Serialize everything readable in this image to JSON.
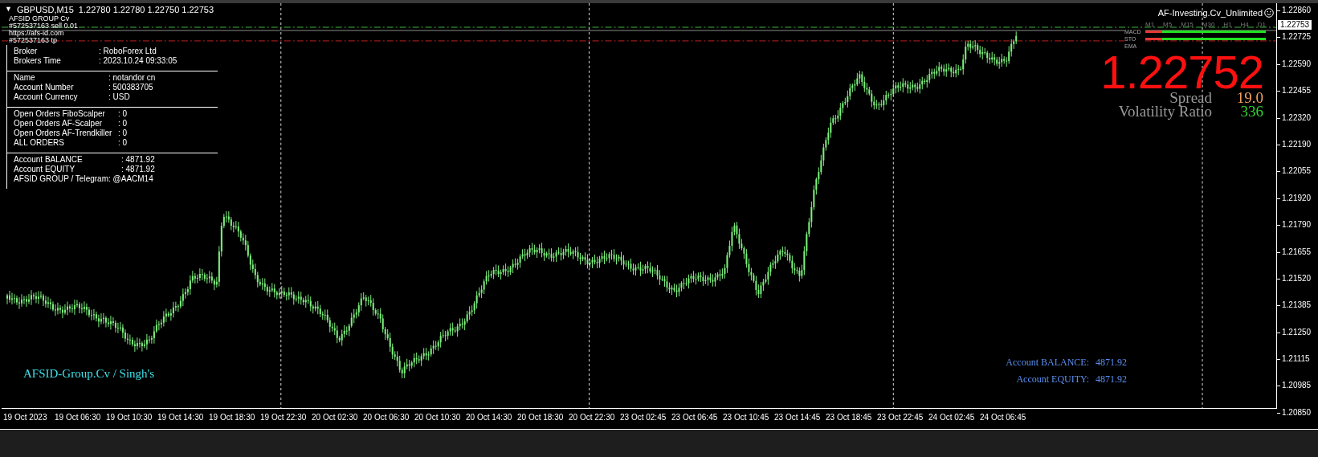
{
  "chart_header": {
    "collapse_glyph": "▼",
    "symbol": "GBPUSD,M15",
    "ohlc": "1.22780 1.22780 1.22750 1.22753"
  },
  "order_labels": [
    "AFSID GROUP Cv",
    "#572537163 sell 0.01",
    "https://afs-id.com",
    "#572537163 tp"
  ],
  "info_panel": {
    "sections": [
      [
        {
          "label": "Broker",
          "value": ": RoboForex Ltd"
        },
        {
          "label": "Brokers Time",
          "value": ": 2023.10.24 09:33:05"
        }
      ],
      [
        {
          "label": "Name",
          "value": ": notandor cn"
        },
        {
          "label": "Account Number",
          "value": ": 500383705"
        },
        {
          "label": "Account Currency",
          "value": ": USD"
        }
      ],
      [
        {
          "label": "Open Orders FiboScalper",
          "value": ": 0"
        },
        {
          "label": "Open Orders AF-Scalper",
          "value": ": 0"
        },
        {
          "label": "Open Orders AF-Trendkiller",
          "value": ": 0"
        },
        {
          "label": "ALL ORDERS",
          "value": ": 0"
        }
      ],
      [
        {
          "label": "Account BALANCE",
          "value": ": 4871.92"
        },
        {
          "label": "Account EQUITY",
          "value": ": 4871.92"
        },
        {
          "label": "AFSID GROUP / Telegram: @AACM14"
        }
      ]
    ]
  },
  "expert": {
    "name": "AF-Investing.Cv_Unlimited"
  },
  "signal_panel": {
    "timeframes": [
      "M1",
      "M5",
      "M15",
      "M30",
      "H1",
      "H4",
      "D1"
    ],
    "rows": [
      {
        "label": "MACD",
        "cells": [
          {
            "color": "#e53935"
          },
          {
            "color": "#22e022"
          },
          {
            "color": "#22e022"
          },
          {
            "color": "#22e022"
          },
          {
            "color": "#22e022"
          },
          {
            "color": "#22e022"
          },
          {
            "color": "#22e022"
          }
        ]
      },
      {
        "label": "STO",
        "cells": [
          {
            "color": "#e53935"
          },
          {
            "color": "#22e022"
          },
          {
            "color": "#22e022"
          },
          {
            "color": "#22e022"
          },
          {
            "color": "#22e022"
          },
          {
            "color": "#22e022"
          },
          {
            "color": "#22e022"
          }
        ]
      },
      {
        "label": "EMA",
        "cells": []
      }
    ]
  },
  "quote": {
    "price": "1.22752",
    "spread_label": "Spread",
    "spread": "19.0",
    "volatility_label": "Volatility Ratio",
    "volatility": "336"
  },
  "brand": "AFSID-Group.Cv / Singh's",
  "account_summary": [
    {
      "label": "Account BALANCE:",
      "value": "4871.92"
    },
    {
      "label": "Account EQUITY:",
      "value": "4871.92"
    }
  ],
  "price_axis": {
    "ticks": [
      "1.22860",
      "1.22725",
      "1.22590",
      "1.22455",
      "1.22320",
      "1.22190",
      "1.22055",
      "1.21920",
      "1.21790",
      "1.21655",
      "1.21520",
      "1.21385",
      "1.21250",
      "1.21115",
      "1.20985",
      "1.20850"
    ],
    "current_price": "1.22753"
  },
  "time_axis": {
    "labels": [
      "19 Oct 2023",
      "19 Oct 06:30",
      "19 Oct 10:30",
      "19 Oct 14:30",
      "19 Oct 18:30",
      "19 Oct 22:30",
      "20 Oct 02:30",
      "20 Oct 06:30",
      "20 Oct 10:30",
      "20 Oct 14:30",
      "20 Oct 18:30",
      "20 Oct 22:30",
      "23 Oct 02:45",
      "23 Oct 06:45",
      "23 Oct 10:45",
      "23 Oct 14:45",
      "23 Oct 18:45",
      "23 Oct 22:45",
      "24 Oct 02:45",
      "24 Oct 06:45"
    ]
  }
}
